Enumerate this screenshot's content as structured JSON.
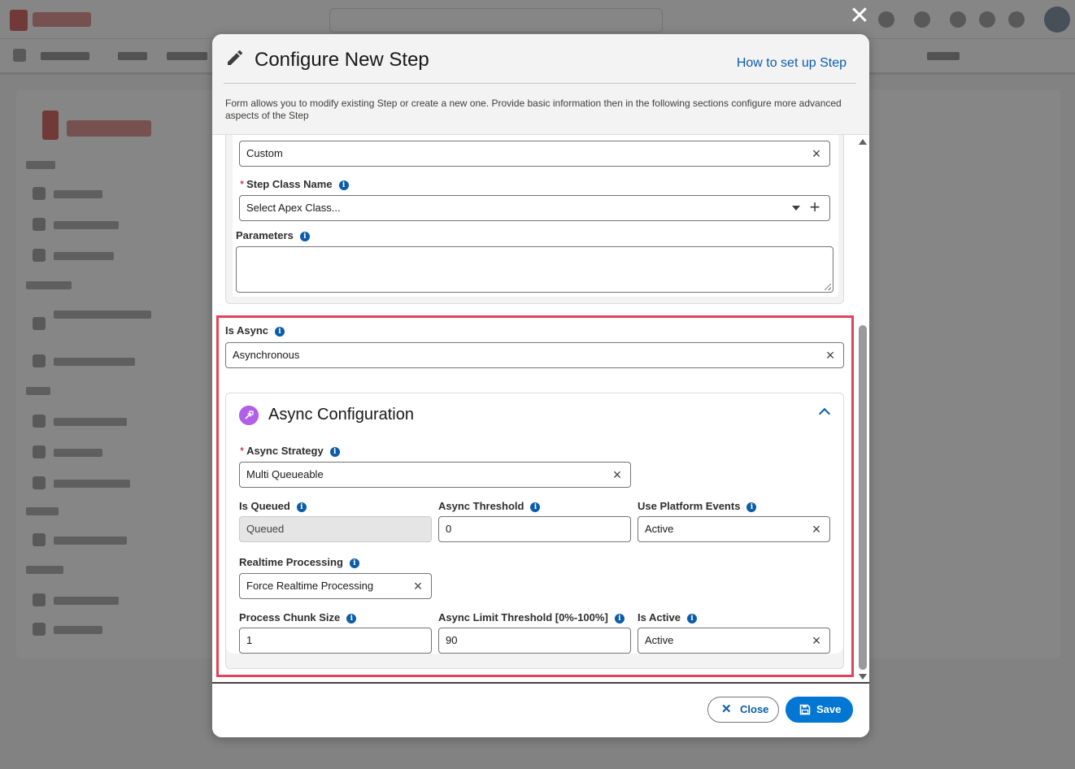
{
  "modal": {
    "title": "Configure New Step",
    "help_link": "How to set up Step",
    "description": "Form allows you to modify existing Step or create a new one. Provide basic information then in the following sections configure more advanced aspects of the Step",
    "close_glyph": "✕",
    "icon": "pencil-icon"
  },
  "upper": {
    "type_value": "Custom",
    "step_class_label": "Step Class Name",
    "step_class_placeholder": "Select Apex Class...",
    "parameters_label": "Parameters",
    "parameters_value": ""
  },
  "async": {
    "is_async_label": "Is Async",
    "is_async_value": "Asynchronous",
    "section_title": "Async Configuration",
    "section_icon": "async-config-icon",
    "strategy_label": "Async Strategy",
    "strategy_value": "Multi Queueable",
    "is_queued_label": "Is Queued",
    "is_queued_value": "Queued",
    "threshold_label": "Async Threshold",
    "threshold_value": "0",
    "platform_events_label": "Use Platform Events",
    "platform_events_value": "Active",
    "realtime_label": "Realtime Processing",
    "realtime_value": "Force Realtime Processing",
    "chunk_label": "Process Chunk Size",
    "chunk_value": "1",
    "limit_label": "Async Limit Threshold [0%-100%]",
    "limit_value": "90",
    "is_active_label": "Is Active",
    "is_active_value": "Active"
  },
  "footer": {
    "close_label": "Close",
    "save_label": "Save"
  },
  "colors": {
    "brand_blue": "#0176d3",
    "link_blue": "#0b5cab",
    "highlight_red": "#e0445b",
    "async_icon_purple": "#b15fe6",
    "required_red": "#ba0517"
  }
}
